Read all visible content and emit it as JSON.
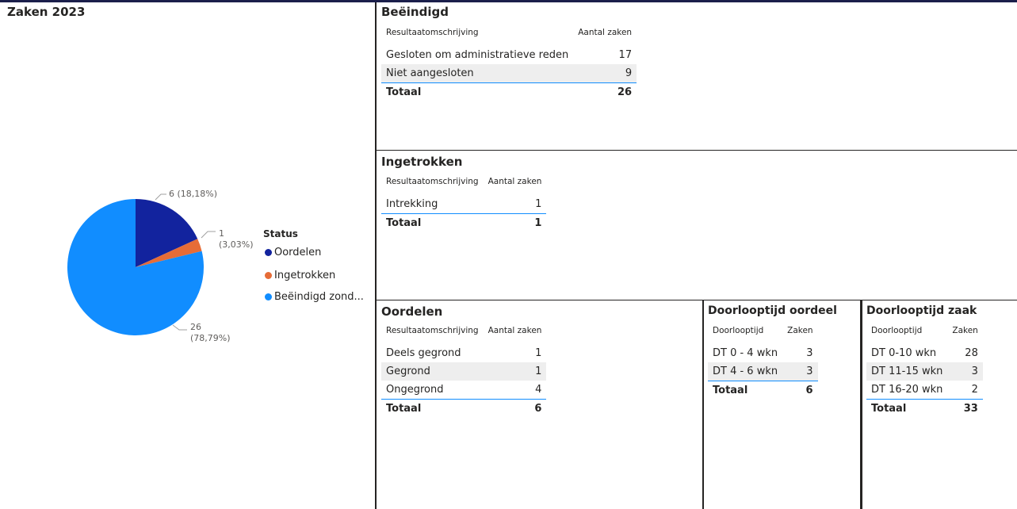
{
  "colors": {
    "oordelen": "#12239e",
    "ingetrokken": "#e66c37",
    "beeindigd": "#118dff",
    "accent": "#118dff"
  },
  "pie": {
    "title": "Zaken 2023",
    "legend_title": "Status",
    "legend": [
      "Oordelen",
      "Ingetrokken",
      "Beëindigd zond..."
    ],
    "labels": {
      "a": "6 (18,18%)",
      "b1": "1",
      "b2": "(3,03%)",
      "c1": "26",
      "c2": "(78,79%)"
    }
  },
  "chart_data": {
    "type": "pie",
    "title": "Zaken 2023",
    "legend_title": "Status",
    "categories": [
      "Oordelen",
      "Ingetrokken",
      "Beëindigd zond..."
    ],
    "values": [
      6,
      1,
      26
    ],
    "percentages": [
      18.18,
      3.03,
      78.79
    ]
  },
  "beeindigd": {
    "title": "Beëindigd",
    "headers": [
      "Resultaatomschrijving",
      "Aantal zaken"
    ],
    "rows": [
      [
        "Gesloten om administratieve reden",
        "17"
      ],
      [
        "Niet aangesloten",
        "9"
      ]
    ],
    "total": [
      "Totaal",
      "26"
    ]
  },
  "ingetrokken": {
    "title": "Ingetrokken",
    "headers": [
      "Resultaatomschrijving",
      "Aantal zaken"
    ],
    "rows": [
      [
        "Intrekking",
        "1"
      ]
    ],
    "total": [
      "Totaal",
      "1"
    ]
  },
  "oordelen": {
    "title": "Oordelen",
    "headers": [
      "Resultaatomschrijving",
      "Aantal zaken"
    ],
    "rows": [
      [
        "Deels gegrond",
        "1"
      ],
      [
        "Gegrond",
        "1"
      ],
      [
        "Ongegrond",
        "4"
      ]
    ],
    "total": [
      "Totaal",
      "6"
    ]
  },
  "doorlooptijd_oordeel": {
    "title": "Doorlooptijd oordeel",
    "headers": [
      "Doorlooptijd",
      "Zaken"
    ],
    "rows": [
      [
        "DT 0 - 4 wkn",
        "3"
      ],
      [
        "DT 4 - 6 wkn",
        "3"
      ]
    ],
    "total": [
      "Totaal",
      "6"
    ]
  },
  "doorlooptijd_zaak": {
    "title": "Doorlooptijd zaak",
    "headers": [
      "Doorlooptijd",
      "Zaken"
    ],
    "rows": [
      [
        "DT 0-10 wkn",
        "28"
      ],
      [
        "DT 11-15 wkn",
        "3"
      ],
      [
        "DT 16-20 wkn",
        "2"
      ]
    ],
    "total": [
      "Totaal",
      "33"
    ]
  }
}
